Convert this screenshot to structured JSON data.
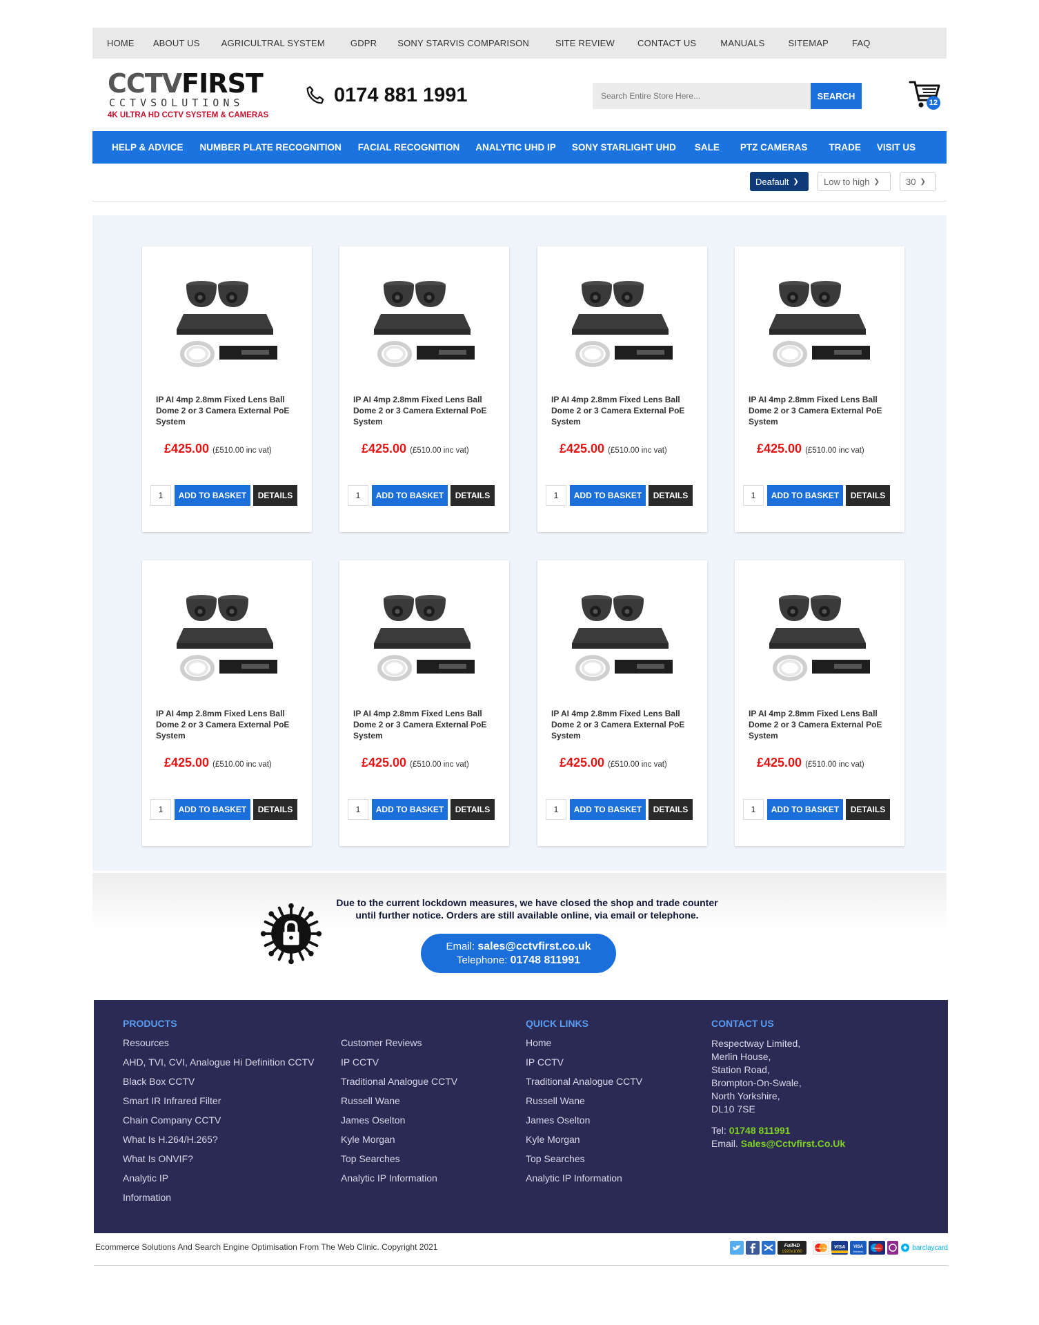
{
  "top_nav": [
    "HOME",
    "ABOUT US",
    "AGRICULTRAL SYSTEM",
    "GDPR",
    "SONY STARVIS COMPARISON",
    "SITE REVIEW",
    "CONTACT US",
    "MANUALS",
    "SITEMAP",
    "FAQ"
  ],
  "logo": {
    "brand_left": "CCTV",
    "brand_right": "FIRST",
    "solutions": "CCTVSOLUTIONS",
    "tagline": "4K ULTRA HD CCTV SYSTEM & CAMERAS"
  },
  "header": {
    "phone": "0174 881 1991",
    "search_placeholder": "Search Entire Store Here...",
    "search_button": "SEARCH",
    "cart_count": "12"
  },
  "main_nav": [
    "HELP & ADVICE",
    "NUMBER PLATE RECOGNITION",
    "FACIAL RECOGNITION",
    "ANALYTIC UHD IP",
    "SONY STARLIGHT UHD",
    "SALE",
    "PTZ CAMERAS",
    "TRADE",
    "VISIT US"
  ],
  "sort": {
    "order": "Deafault",
    "price": "Low to high",
    "per_page": "30"
  },
  "products": [
    {
      "title": "IP AI 4mp 2.8mm Fixed Lens Ball Dome 2 or 3 Camera External PoE System",
      "price": "£425.00",
      "price_inc": "(£510.00 inc vat)",
      "qty": "1",
      "add": "ADD TO BASKET",
      "details": "DETAILS"
    },
    {
      "title": "IP AI 4mp 2.8mm Fixed Lens Ball Dome 2 or 3 Camera External PoE System",
      "price": "£425.00",
      "price_inc": "(£510.00 inc vat)",
      "qty": "1",
      "add": "ADD TO BASKET",
      "details": "DETAILS"
    },
    {
      "title": "IP AI 4mp 2.8mm Fixed Lens Ball Dome 2 or 3 Camera External PoE System",
      "price": "£425.00",
      "price_inc": "(£510.00 inc vat)",
      "qty": "1",
      "add": "ADD TO BASKET",
      "details": "DETAILS"
    },
    {
      "title": "IP AI 4mp 2.8mm Fixed Lens Ball Dome 2 or 3 Camera External PoE System",
      "price": "£425.00",
      "price_inc": "(£510.00 inc vat)",
      "qty": "1",
      "add": "ADD TO BASKET",
      "details": "DETAILS"
    },
    {
      "title": "IP AI 4mp 2.8mm Fixed Lens Ball Dome 2 or 3 Camera External PoE System",
      "price": "£425.00",
      "price_inc": "(£510.00 inc vat)",
      "qty": "1",
      "add": "ADD TO BASKET",
      "details": "DETAILS"
    },
    {
      "title": "IP AI 4mp 2.8mm Fixed Lens Ball Dome 2 or 3 Camera External PoE System",
      "price": "£425.00",
      "price_inc": "(£510.00 inc vat)",
      "qty": "1",
      "add": "ADD TO BASKET",
      "details": "DETAILS"
    },
    {
      "title": "IP AI 4mp 2.8mm Fixed Lens Ball Dome 2 or 3 Camera External PoE System",
      "price": "£425.00",
      "price_inc": "(£510.00 inc vat)",
      "qty": "1",
      "add": "ADD TO BASKET",
      "details": "DETAILS"
    },
    {
      "title": "IP AI 4mp 2.8mm Fixed Lens Ball Dome 2 or 3 Camera External PoE System",
      "price": "£425.00",
      "price_inc": "(£510.00 inc vat)",
      "qty": "1",
      "add": "ADD TO BASKET",
      "details": "DETAILS"
    }
  ],
  "lockdown": {
    "line1": "Due to the current lockdown measures, we have closed the shop and trade counter",
    "line2": "until further notice. Orders are still available online, via email or telephone.",
    "email_label": "Email:",
    "email": "sales@cctvfirst.co.uk",
    "tel_label": "Telephone:",
    "tel": "01748 811991"
  },
  "footer": {
    "products_heading": "PRODUCTS",
    "products": [
      "Resources",
      "AHD, TVI, CVI, Analogue Hi Definition CCTV",
      "Black Box CCTV",
      "Smart IR Infrared Filter",
      "Chain Company CCTV",
      "What Is H.264/H.265?",
      "What Is ONVIF?",
      "Analytic IP",
      "Information"
    ],
    "col2": [
      "Customer Reviews",
      "IP CCTV",
      "Traditional Analogue CCTV",
      "Russell Wane",
      "James Oselton",
      "Kyle Morgan",
      "Top Searches",
      "Analytic IP Information"
    ],
    "quick_heading": "QUICK LINKS",
    "quick": [
      "Home",
      "IP CCTV",
      "Traditional Analogue CCTV",
      "Russell Wane",
      "James Oselton",
      "Kyle Morgan",
      "Top Searches",
      "Analytic IP Information"
    ],
    "contact_heading": "CONTACT US",
    "address": [
      "Respectway Limited,",
      "Merlin House,",
      "Station Road,",
      "Brompton-On-Swale,",
      "North Yorkshire,",
      "DL10 7SE"
    ],
    "tel_label": "Tel:",
    "tel": "01748 811991",
    "email_label": "Email.",
    "email": "Sales@Cctvfirst.Co.Uk"
  },
  "copyright": "Ecommerce Solutions And Search Engine Optimisation From The Web Clinic. Copyright 2021",
  "badges": {
    "hd": "FullHD",
    "hd_sub": "1920x1080",
    "mastercard": "MasterCard",
    "visa": "VISA",
    "visa_e": "VISA Electron",
    "maestro": "Maestro",
    "barclaycard": "barclaycard"
  },
  "colors": {
    "brand_blue": "#1a73de",
    "footer_bg": "#2b2a55",
    "price_red": "#e31515",
    "footer_green": "#7ed321"
  }
}
